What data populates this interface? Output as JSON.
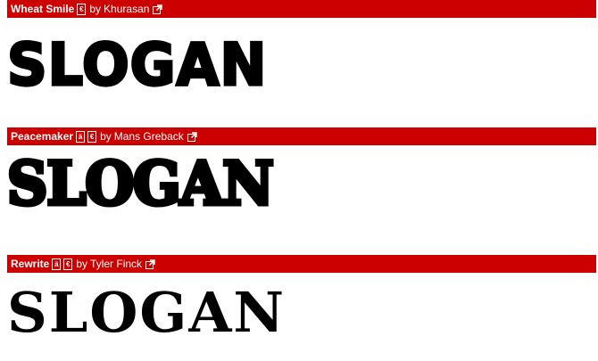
{
  "fonts": [
    {
      "name": "Wheat Smile",
      "badges": [
        "€"
      ],
      "by": "by",
      "author": "Khurasan",
      "sample": "SLOGAN"
    },
    {
      "name": "Peacemaker",
      "badges": [
        "ä",
        "€"
      ],
      "by": "by",
      "author": "Mans Greback",
      "sample": "SLOGAN"
    },
    {
      "name": "Rewrite",
      "badges": [
        "ä",
        "€"
      ],
      "by": "by",
      "author": "Tyler Finck",
      "sample": "SLOGAN"
    }
  ],
  "colors": {
    "header_bg": "#cc0000",
    "header_text": "#ffffff",
    "sample_text": "#000000"
  },
  "icons": {
    "external": "external-link-icon"
  }
}
